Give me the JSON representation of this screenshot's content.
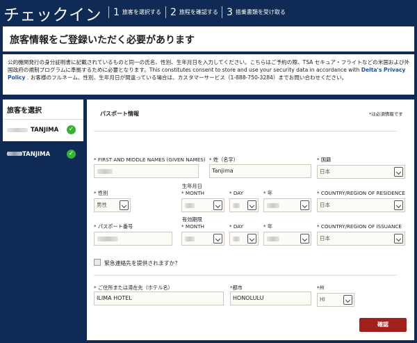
{
  "header": {
    "title": "チェックイン",
    "steps": [
      {
        "num": "1",
        "label": "旅客を選択する"
      },
      {
        "num": "2",
        "label": "旅程を確認する"
      },
      {
        "num": "3",
        "label": "搭乗書類を受け取る"
      }
    ]
  },
  "banner": {
    "title": "旅客情報をご登録いただく必要があります"
  },
  "info": {
    "text_before_link": "公的機関発行の身分証明書に記載されているものと同一の氏名、性別、生年月日を入力してください。こちらはご予約の際、TSA セキュア・フライトなどの米国および外国政府の規制プログラムに準拠するために必要となります。This constitutes consent to store and use your security data in accordance with ",
    "link": "Delta's Privacy Policy",
    "text_after_link": " . お客様のフルネーム、性別、生年月日が間違っている場合は、カスタマーサービス（1-888-750-3284）までお問い合わせください。"
  },
  "sidebar": {
    "heading": "旅客を選択",
    "passengers": [
      {
        "name": "TANJIMA",
        "selected": false
      },
      {
        "name": "TANJIMA",
        "selected": true
      }
    ]
  },
  "form": {
    "section_title": "パスポート情報",
    "required_note": "*は必須情報です",
    "given_names_label": "* FIRST AND MIDDLE NAMES (GIVEN NAMES)",
    "surname_label": "* 姓（名字）",
    "surname_value": "Tanjima",
    "nationality_label": "* 国籍",
    "nationality_value": "日本",
    "gender_label": "* 性別",
    "gender_value": "男性",
    "dob_group_label": "生年月日",
    "month_label": "* MONTH",
    "day_label": "* DAY",
    "year_label": "* 年",
    "residence_label": "* COUNTRY/REGION OF RESIDENCE",
    "residence_value": "日本",
    "passport_label": "* パスポート番号",
    "expiry_group_label": "有効期限",
    "exp_month_label": "* MONTH",
    "exp_day_label": "* DAY",
    "exp_year_label": "* 年",
    "issuance_label": "* COUNTRY/REGION OF ISSUANCE",
    "issuance_value": "日本",
    "emergency_label": "緊急連絡先を提供されますか？",
    "address_label": "* ご住所または滞在先（ホテル名）",
    "address_value": "ILIMA HOTEL",
    "city_label": "*都市",
    "city_value": "HONOLULU",
    "state_label": "*州",
    "state_value": "HI",
    "confirm_label": "確認"
  },
  "colors": {
    "navy": "#0e2a55",
    "confirm": "#a11f1c",
    "check": "#34b233",
    "link": "#1a53a6"
  }
}
